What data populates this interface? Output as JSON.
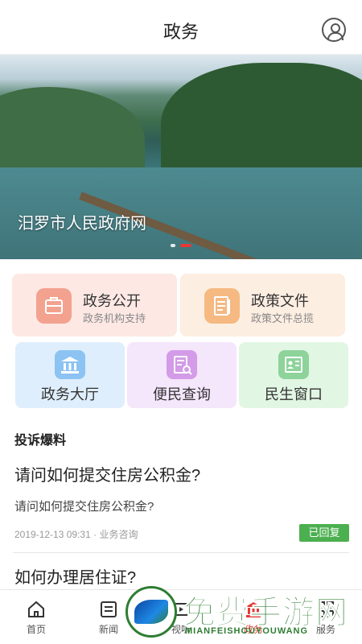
{
  "header": {
    "title": "政务"
  },
  "banner": {
    "caption": "汨罗市人民政府网"
  },
  "services_primary": [
    {
      "title": "政务公开",
      "subtitle": "政务机构支持",
      "bg": "#fde8e4",
      "icon_bg": "#f3a28f",
      "icon": "briefcase-icon"
    },
    {
      "title": "政策文件",
      "subtitle": "政策文件总揽",
      "bg": "#fdeee2",
      "icon_bg": "#f5b981",
      "icon": "document-icon"
    }
  ],
  "services_secondary": [
    {
      "title": "政务大厅",
      "bg": "#dfeefc",
      "icon_bg": "#8cc3f2",
      "icon": "government-building-icon"
    },
    {
      "title": "便民查询",
      "bg": "#f4e6fb",
      "icon_bg": "#d39be8",
      "icon": "search-document-icon"
    },
    {
      "title": "民生窗口",
      "bg": "#e2f6e4",
      "icon_bg": "#8dd39a",
      "icon": "id-card-icon"
    }
  ],
  "complaints": {
    "section_title": "投诉爆料",
    "items": [
      {
        "title": "请问如何提交住房公积金?",
        "summary": "请问如何提交住房公积金?",
        "date": "2019-12-13 09:31",
        "category": "业务咨询",
        "status": "已回复"
      },
      {
        "title": "如何办理居住证?"
      }
    ]
  },
  "tabbar": {
    "items": [
      {
        "label": "首页",
        "icon": "home-icon"
      },
      {
        "label": "新闻",
        "icon": "news-icon"
      },
      {
        "label": "视听",
        "icon": "video-icon"
      },
      {
        "label": "政务",
        "icon": "government-icon",
        "active": true
      },
      {
        "label": "服务",
        "icon": "service-icon"
      }
    ]
  },
  "watermark": {
    "text": "免费手游网",
    "subtext": "MIANFEISHOUYOUWANG"
  },
  "colors": {
    "accent": "#e53935",
    "badge": "#4caf50"
  }
}
